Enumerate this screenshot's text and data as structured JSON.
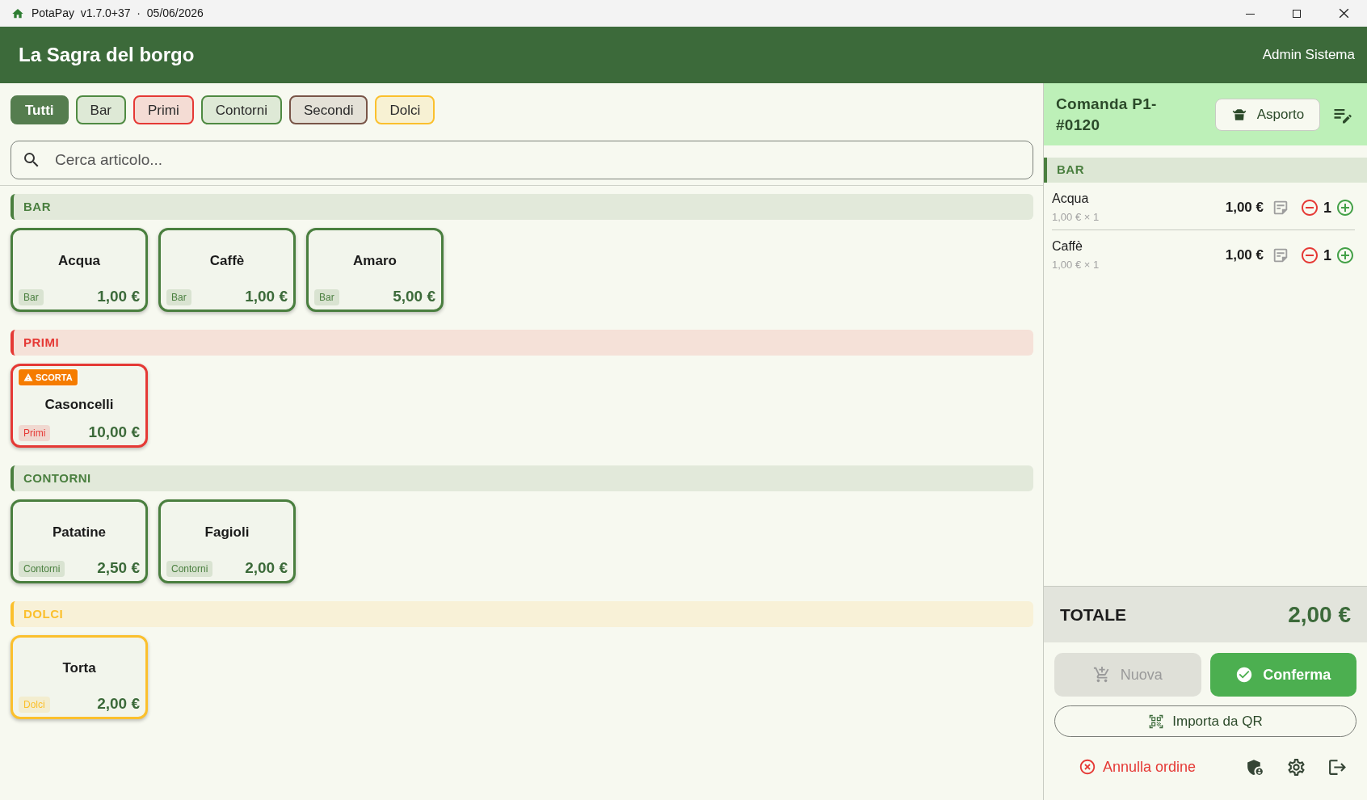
{
  "window": {
    "title": "PotaPay  v1.7.0+37  ·  05/06/2026"
  },
  "header": {
    "title": "La Sagra del borgo",
    "user": "Admin Sistema"
  },
  "filters": [
    {
      "label": "Tutti",
      "selected": true,
      "color": "#557d4f"
    },
    {
      "label": "Bar",
      "selected": false,
      "color": "#4f8a42"
    },
    {
      "label": "Primi",
      "selected": false,
      "color": "#e53935"
    },
    {
      "label": "Contorni",
      "selected": false,
      "color": "#4f8a42"
    },
    {
      "label": "Secondi",
      "selected": false,
      "color": "#795548"
    },
    {
      "label": "Dolci",
      "selected": false,
      "color": "#fbc02d"
    }
  ],
  "search": {
    "placeholder": "Cerca articolo..."
  },
  "sections": [
    {
      "title": "BAR",
      "color": "#4a7f3f",
      "items": [
        {
          "name": "Acqua",
          "tag": "Bar",
          "price": "1,00 €"
        },
        {
          "name": "Caffè",
          "tag": "Bar",
          "price": "1,00 €"
        },
        {
          "name": "Amaro",
          "tag": "Bar",
          "price": "5,00 €"
        }
      ]
    },
    {
      "title": "PRIMI",
      "color": "#e53935",
      "items": [
        {
          "name": "Casoncelli",
          "tag": "Primi",
          "price": "10,00 €",
          "badge": "SCORTA"
        }
      ]
    },
    {
      "title": "CONTORNI",
      "color": "#4a7f3f",
      "items": [
        {
          "name": "Patatine",
          "tag": "Contorni",
          "price": "2,50 €"
        },
        {
          "name": "Fagioli",
          "tag": "Contorni",
          "price": "2,00 €"
        }
      ]
    },
    {
      "title": "DOLCI",
      "color": "#fbc02d",
      "items": [
        {
          "name": "Torta",
          "tag": "Dolci",
          "price": "2,00 €"
        }
      ]
    }
  ],
  "order": {
    "title": "Comanda P1-#0120",
    "service_button": "Asporto",
    "groups": [
      {
        "title": "BAR",
        "color": "#4a7f3f",
        "lines": [
          {
            "name": "Acqua",
            "detail": "1,00 € × 1",
            "amount": "1,00 €",
            "quantity": "1"
          },
          {
            "name": "Caffè",
            "detail": "1,00 € × 1",
            "amount": "1,00 €",
            "quantity": "1"
          }
        ]
      }
    ],
    "total_label": "TOTALE",
    "total": "2,00 €",
    "new_button": {
      "label": "Nuova",
      "disabled": true
    },
    "confirm_button": {
      "label": "Conferma"
    },
    "qr_button": {
      "label": "Importa da QR"
    },
    "cancel_button": {
      "label": "Annulla ordine"
    }
  }
}
